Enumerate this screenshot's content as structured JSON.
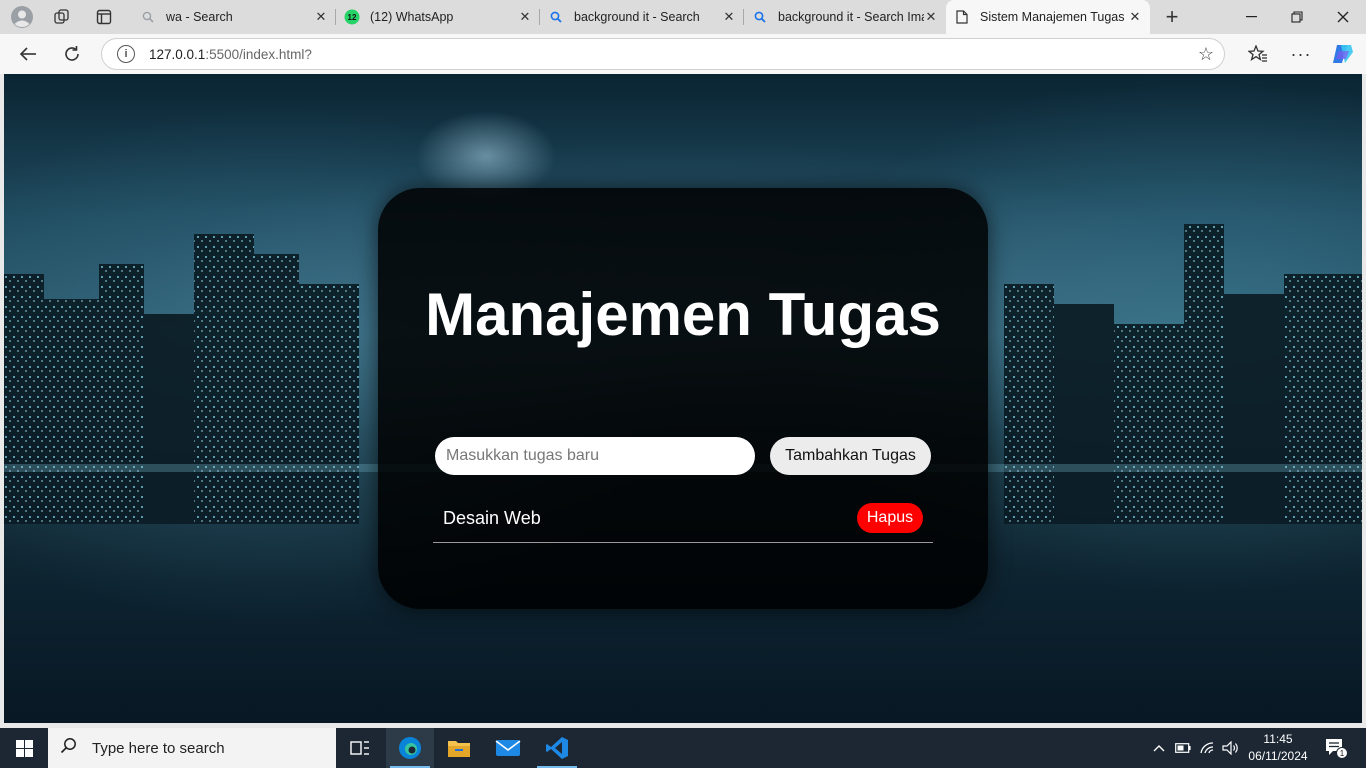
{
  "browser": {
    "tabs": [
      {
        "title": "wa - Search",
        "favicon": "search-icon"
      },
      {
        "title": "(12) WhatsApp",
        "favicon": "whatsapp-icon",
        "badge": "12"
      },
      {
        "title": "background it - Search",
        "favicon": "search-icon"
      },
      {
        "title": "background it - Search Ima",
        "favicon": "search-icon"
      },
      {
        "title": "Sistem Manajemen Tugas",
        "favicon": "page-icon"
      }
    ],
    "url_host": "127.0.0.1",
    "url_rest": ":5500/index.html?"
  },
  "app": {
    "title": "Manajemen Tugas",
    "input_placeholder": "Masukkan tugas baru",
    "add_button": "Tambahkan Tugas",
    "tasks": [
      {
        "text": "Desain Web",
        "delete_label": "Hapus"
      }
    ]
  },
  "taskbar": {
    "search_placeholder": "Type here to search",
    "time": "11:45",
    "date": "06/11/2024",
    "notification_count": "1"
  },
  "colors": {
    "delete_button": "#ff0000",
    "card_background": "#000000",
    "whatsapp": "#25d366",
    "edge_blue": "#0078d4"
  }
}
